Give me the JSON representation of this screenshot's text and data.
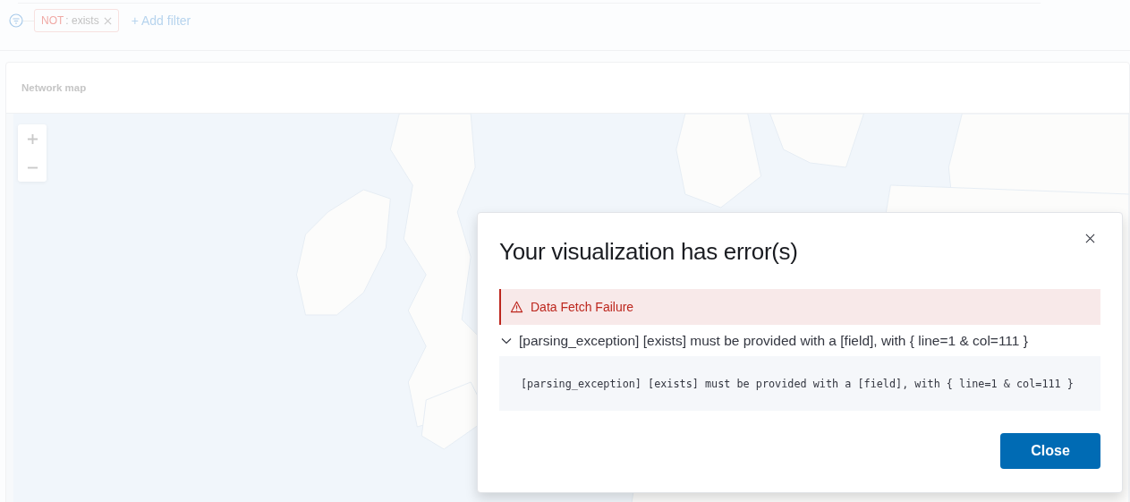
{
  "filter_bar": {
    "filters": [
      {
        "prefix": "NOT",
        "text": ": exists"
      }
    ],
    "add_filter": "+ Add filter"
  },
  "panel": {
    "title": "Network map"
  },
  "modal": {
    "title": "Your visualization has error(s)",
    "callout": {
      "title": "Data Fetch Failure"
    },
    "error": {
      "summary": "[parsing_exception] [exists] must be provided with a [field], with { line=1 & col=111 }",
      "expanded": true,
      "detail": "[parsing_exception] [exists] must be provided with a [field], with { line=1 & col=111 }"
    },
    "buttons": [
      "Close"
    ]
  }
}
